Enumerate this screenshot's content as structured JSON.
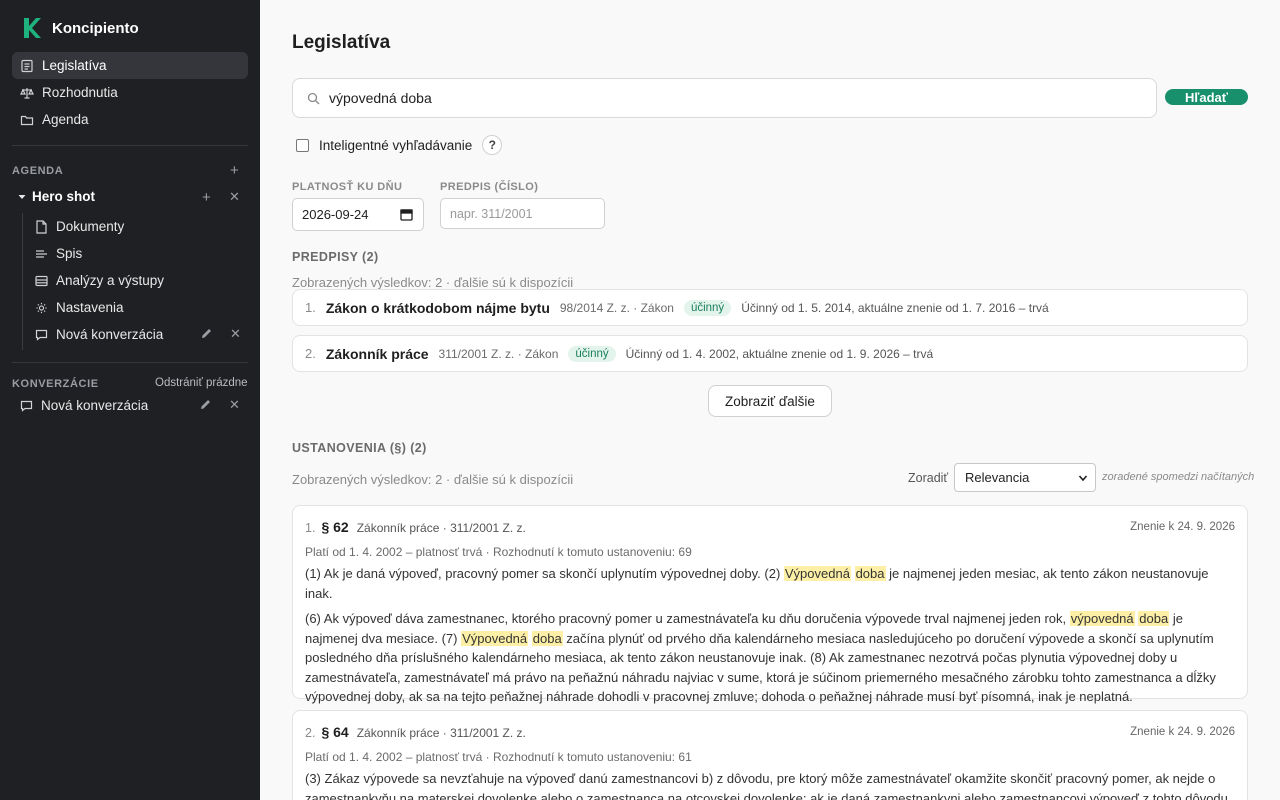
{
  "sidebar": {
    "brand": "Koncipiento",
    "nav": [
      {
        "label": "Legislatíva",
        "icon": "document-list-icon",
        "active": true
      },
      {
        "label": "Rozhodnutia",
        "icon": "scales-icon",
        "active": false
      },
      {
        "label": "Agenda",
        "icon": "folder-icon",
        "active": false
      }
    ],
    "agenda_label": "AGENDA",
    "case": {
      "name": "Hero shot",
      "items": [
        {
          "label": "Dokumenty",
          "icon": "file-icon"
        },
        {
          "label": "Spis",
          "icon": "list-lines-icon"
        },
        {
          "label": "Analýzy a výstupy",
          "icon": "table-icon"
        },
        {
          "label": "Nastavenia",
          "icon": "gear-icon"
        },
        {
          "label": "Nová konverzácia",
          "icon": "chat-bubble-icon"
        }
      ]
    },
    "conversations_label": "KONVERZÁCIE",
    "conversations_action": "Odstrániť prázdne",
    "conversations": [
      {
        "label": "Nová konverzácia"
      }
    ]
  },
  "main": {
    "title": "Legislatíva",
    "search": {
      "value": "výpovedná doba",
      "button": "Hľadať"
    },
    "smart_search": {
      "label": "Inteligentné vyhľadávanie",
      "help": "?",
      "checked": false
    },
    "filters": {
      "date_label": "PLATNOSŤ KU DŇU",
      "date_value": "2026-09-24",
      "regulation_label": "PREDPIS (ČÍSLO)",
      "regulation_placeholder": "napr. 311/2001"
    },
    "regulations": {
      "heading": "PREDPISY (2)",
      "note": "Zobrazených výsledkov: 2 · ďalšie sú k dispozícii",
      "items": [
        {
          "num": "1.",
          "title": "Zákon o krátkodobom nájme bytu",
          "meta": "98/2014 Z. z. · Zákon",
          "badge": "účinný",
          "validity": "Účinný od 1. 5. 2014, aktuálne znenie od 1. 7. 2016 – trvá"
        },
        {
          "num": "2.",
          "title": "Zákonník práce",
          "meta": "311/2001 Z. z. · Zákon",
          "badge": "účinný",
          "validity": "Účinný od 1. 4. 2002, aktuálne znenie od 1. 9. 2026 – trvá"
        }
      ],
      "more_button": "Zobraziť ďalšie"
    },
    "provisions": {
      "heading": "USTANOVENIA (§) (2)",
      "note": "Zobrazených výsledkov: 2 · ďalšie sú k dispozícii",
      "sort_label": "Zoradiť",
      "sort_value": "Relevancia",
      "sort_note": "zoradené spomedzi načítaných",
      "items": [
        {
          "num": "1.",
          "para": "§ 62",
          "source": "Zákonník práce · 311/2001 Z. z.",
          "version": "Znenie k 24. 9. 2026",
          "validity": "Platí od 1. 4. 2002 – platnosť trvá · Rozhodnutí k tomuto ustanoveniu: 69",
          "p1": [
            {
              "t": "(1) Ak je daná výpoveď, pracovný pomer sa skončí uplynutím výpovednej doby. (2) "
            },
            {
              "t": "Výpovedná",
              "hl": true
            },
            {
              "t": " "
            },
            {
              "t": "doba",
              "hl": true
            },
            {
              "t": " je najmenej jeden mesiac, ak tento zákon neustanovuje inak."
            }
          ],
          "p2": [
            {
              "t": "(6) Ak výpoveď dáva zamestnanec, ktorého pracovný pomer u zamestnávateľa ku dňu doručenia výpovede trval najmenej jeden rok, "
            },
            {
              "t": "výpovedná",
              "hl": true
            },
            {
              "t": " "
            },
            {
              "t": "doba",
              "hl": true
            },
            {
              "t": " je najmenej dva mesiace. (7) "
            },
            {
              "t": "Výpovedná",
              "hl": true
            },
            {
              "t": " "
            },
            {
              "t": "doba",
              "hl": true
            },
            {
              "t": " začína plynúť od prvého dňa kalendárneho mesiaca nasledujúceho po doručení výpovede a skončí sa uplynutím posledného dňa príslušného kalendárneho mesiaca, ak tento zákon neustanovuje inak. (8) Ak zamestnanec nezotrvá počas plynutia výpovednej doby u zamestnávateľa, zamestnávateľ má právo na peňažnú náhradu najviac v sume, ktorá je súčinom priemerného mesačného zárobku tohto zamestnanca a dĺžky výpovednej doby, ak sa na tejto peňažnej náhrade dohodli v pracovnej zmluve; dohoda o peňažnej náhrade musí byť písomná, inak je neplatná."
            }
          ]
        },
        {
          "num": "2.",
          "para": "§ 64",
          "source": "Zákonník práce · 311/2001 Z. z.",
          "version": "Znenie k 24. 9. 2026",
          "validity": "Platí od 1. 4. 2002 – platnosť trvá · Rozhodnutí k tomuto ustanoveniu: 61",
          "p1": [
            {
              "t": "(3) Zákaz výpovede sa nevzťahuje na výpoveď danú zamestnancovi b) z dôvodu, pre ktorý môže zamestnávateľ okamžite skončiť pracovný pomer, ak nejde o zamestnankyňu na materskej dovolenke alebo o zamestnanca na otcovskej dovolenke; ak je daná zamestnankyni alebo zamestnancovi výpoveď z tohto dôvodu"
            }
          ]
        }
      ]
    }
  }
}
